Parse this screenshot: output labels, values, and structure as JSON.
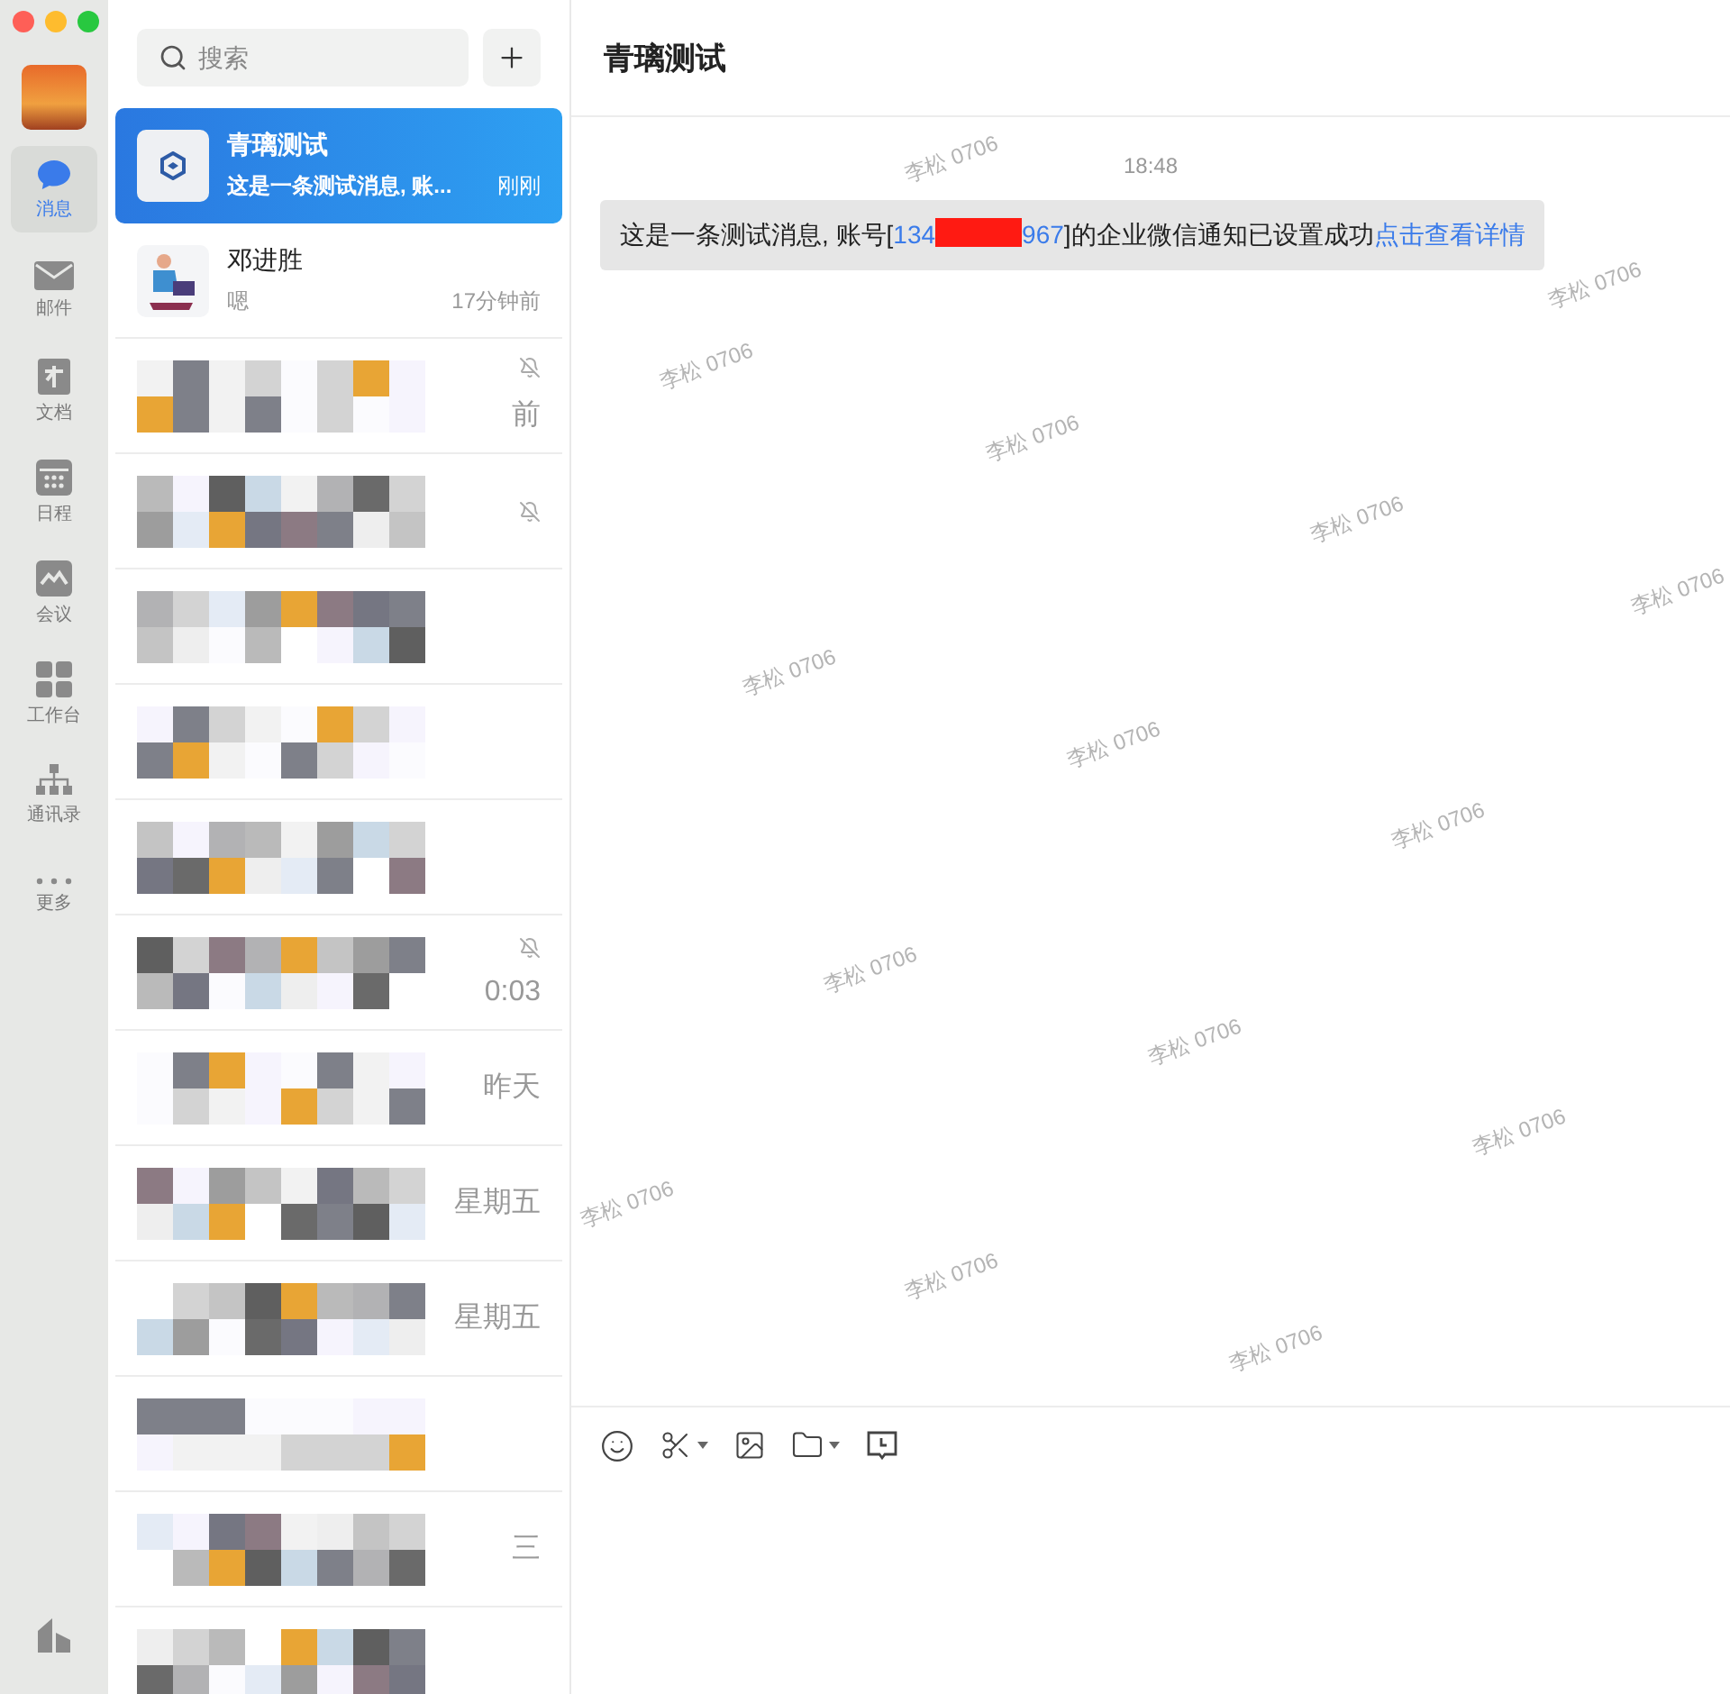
{
  "rail": {
    "items": [
      {
        "kind": "chat",
        "label": "消息",
        "selected": true
      },
      {
        "kind": "mail",
        "label": "邮件",
        "selected": false
      },
      {
        "kind": "doc",
        "label": "文档",
        "selected": false
      },
      {
        "kind": "calendar",
        "label": "日程",
        "selected": false
      },
      {
        "kind": "meeting",
        "label": "会议",
        "selected": false
      },
      {
        "kind": "apps",
        "label": "工作台",
        "selected": false
      },
      {
        "kind": "contacts",
        "label": "通讯录",
        "selected": false
      },
      {
        "kind": "more",
        "label": "更多",
        "selected": false
      }
    ]
  },
  "search": {
    "placeholder": "搜索"
  },
  "conversations": [
    {
      "kind": "app",
      "name": "青璃测试",
      "preview": "这是一条测试消息, 账...",
      "time": "刚刚",
      "selected": true,
      "muted": false
    },
    {
      "kind": "person",
      "name": "邓进胜",
      "preview": "嗯",
      "time": "17分钟前",
      "selected": false,
      "muted": false
    },
    {
      "kind": "obscured",
      "time": "前",
      "selected": false,
      "muted": true
    },
    {
      "kind": "obscured",
      "selected": false,
      "muted": true
    },
    {
      "kind": "obscured",
      "selected": false,
      "muted": false
    },
    {
      "kind": "obscured",
      "selected": false,
      "muted": false
    },
    {
      "kind": "obscured",
      "selected": false,
      "muted": false
    },
    {
      "kind": "obscured",
      "time": "0:03",
      "selected": false,
      "muted": true
    },
    {
      "kind": "obscured",
      "time": "昨天",
      "selected": false,
      "muted": false
    },
    {
      "kind": "obscured",
      "time": "星期五",
      "selected": false,
      "muted": false
    },
    {
      "kind": "obscured",
      "time": "星期五",
      "selected": false,
      "muted": false
    },
    {
      "kind": "obscured",
      "selected": false,
      "muted": false
    },
    {
      "kind": "obscured",
      "time": "三",
      "selected": false,
      "muted": false
    },
    {
      "kind": "obscured",
      "selected": false,
      "muted": false
    }
  ],
  "chat": {
    "title": "青璃测试",
    "messages": [
      {
        "time": "18:48",
        "parts": [
          {
            "kind": "text",
            "text": "这是一条测试消息, 账号["
          },
          {
            "kind": "number",
            "text": "134"
          },
          {
            "kind": "redaction"
          },
          {
            "kind": "number",
            "text": "967"
          },
          {
            "kind": "text",
            "text": "]的企业微信通知已设置成功"
          },
          {
            "kind": "link",
            "text": "点击查看详情"
          }
        ]
      }
    ],
    "watermarks": [
      "李松 0706",
      "李松 0706",
      "李松 0706",
      "李松 0706",
      "李松 0706",
      "李松 0706",
      "李松 0706",
      "李松 0706",
      "李松 0706",
      "李松 0706",
      "李松 0706",
      "李松 0706",
      "李松 0706",
      "李松 0706",
      "李松 0706"
    ]
  }
}
